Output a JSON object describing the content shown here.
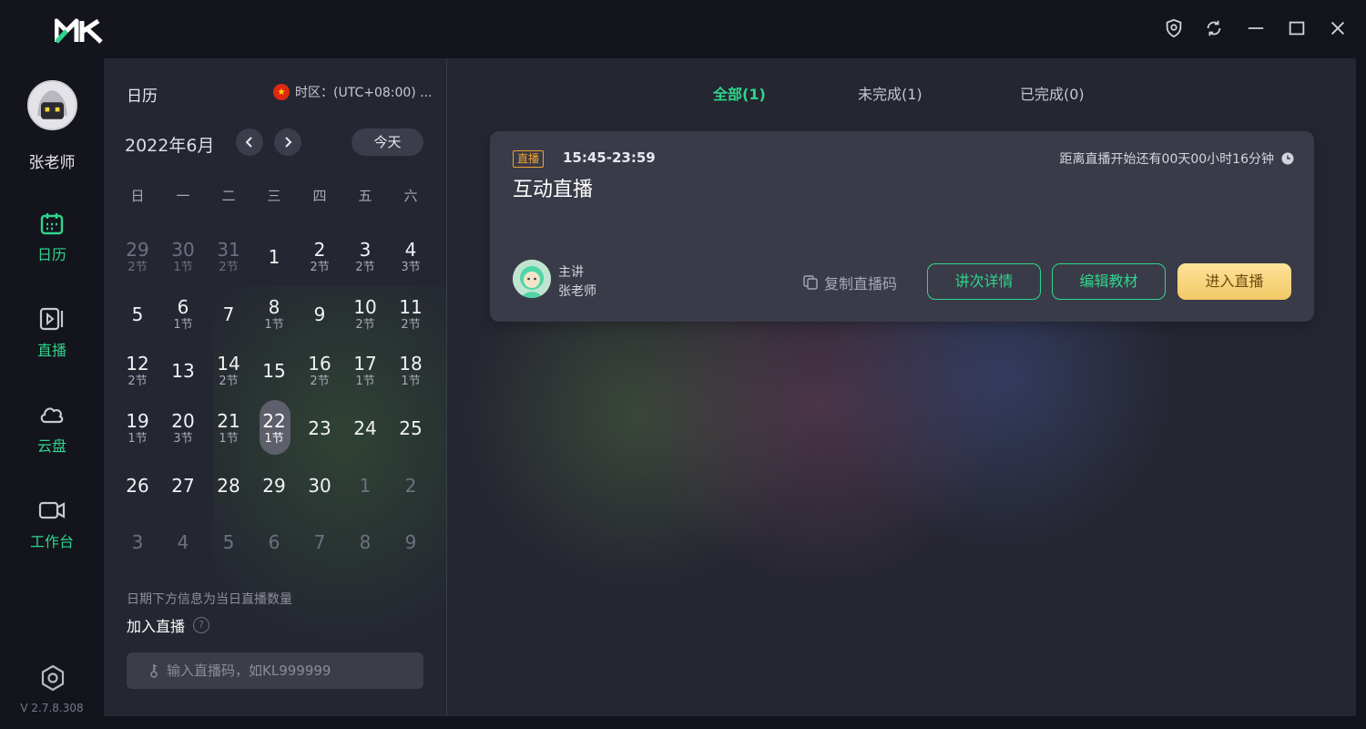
{
  "app": {
    "logo_icon": "mk-logo",
    "version": "V 2.7.8.308",
    "accent": "#2fd58c",
    "window_controls": [
      "shield-icon",
      "refresh-icon",
      "minimize-icon",
      "maximize-icon",
      "close-icon"
    ]
  },
  "sidebar": {
    "user_name": "张老师",
    "items": [
      {
        "label": "日历",
        "icon": "calendar-icon"
      },
      {
        "label": "直播",
        "icon": "play-icon"
      },
      {
        "label": "云盘",
        "icon": "cloud-icon"
      },
      {
        "label": "工作台",
        "icon": "camera-icon"
      }
    ],
    "settings_icon": "settings-icon"
  },
  "calendar": {
    "title": "日历",
    "timezone": "时区：(UTC+08:00) ...",
    "month": "2022年6月",
    "today_label": "今天",
    "weekdays": [
      "日",
      "一",
      "二",
      "三",
      "四",
      "五",
      "六"
    ],
    "days": [
      {
        "d": "29",
        "c": "2节",
        "other": true
      },
      {
        "d": "30",
        "c": "1节",
        "other": true
      },
      {
        "d": "31",
        "c": "2节",
        "other": true
      },
      {
        "d": "1",
        "c": ""
      },
      {
        "d": "2",
        "c": "2节"
      },
      {
        "d": "3",
        "c": "2节"
      },
      {
        "d": "4",
        "c": "3节"
      },
      {
        "d": "5",
        "c": ""
      },
      {
        "d": "6",
        "c": "1节"
      },
      {
        "d": "7",
        "c": ""
      },
      {
        "d": "8",
        "c": "1节"
      },
      {
        "d": "9",
        "c": ""
      },
      {
        "d": "10",
        "c": "2节"
      },
      {
        "d": "11",
        "c": "2节"
      },
      {
        "d": "12",
        "c": "2节"
      },
      {
        "d": "13",
        "c": ""
      },
      {
        "d": "14",
        "c": "2节"
      },
      {
        "d": "15",
        "c": ""
      },
      {
        "d": "16",
        "c": "2节"
      },
      {
        "d": "17",
        "c": "1节"
      },
      {
        "d": "18",
        "c": "1节"
      },
      {
        "d": "19",
        "c": "1节"
      },
      {
        "d": "20",
        "c": "3节"
      },
      {
        "d": "21",
        "c": "1节"
      },
      {
        "d": "22",
        "c": "1节",
        "selected": true
      },
      {
        "d": "23",
        "c": ""
      },
      {
        "d": "24",
        "c": ""
      },
      {
        "d": "25",
        "c": ""
      },
      {
        "d": "26",
        "c": ""
      },
      {
        "d": "27",
        "c": ""
      },
      {
        "d": "28",
        "c": ""
      },
      {
        "d": "29",
        "c": ""
      },
      {
        "d": "30",
        "c": ""
      },
      {
        "d": "1",
        "c": "",
        "other": true
      },
      {
        "d": "2",
        "c": "",
        "other": true
      },
      {
        "d": "3",
        "c": "",
        "other": true
      },
      {
        "d": "4",
        "c": "",
        "other": true
      },
      {
        "d": "5",
        "c": "",
        "other": true
      },
      {
        "d": "6",
        "c": "",
        "other": true
      },
      {
        "d": "7",
        "c": "",
        "other": true
      },
      {
        "d": "8",
        "c": "",
        "other": true
      },
      {
        "d": "9",
        "c": "",
        "other": true
      }
    ],
    "hint": "日期下方信息为当日直播数量",
    "join_label": "加入直播",
    "join_placeholder": "输入直播码，如KL999999"
  },
  "main": {
    "tabs": [
      {
        "label": "全部(1)",
        "active": true
      },
      {
        "label": "未完成(1)"
      },
      {
        "label": "已完成(0)"
      }
    ],
    "card": {
      "badge": "直播",
      "time": "15:45-23:59",
      "countdown": "距离直播开始还有00天00小时16分钟",
      "title": "互动直播",
      "role": "主讲",
      "teacher": "张老师",
      "copy_code": "复制直播码",
      "details_button": "讲次详情",
      "edit_button": "编辑教材",
      "enter_button": "进入直播"
    }
  }
}
